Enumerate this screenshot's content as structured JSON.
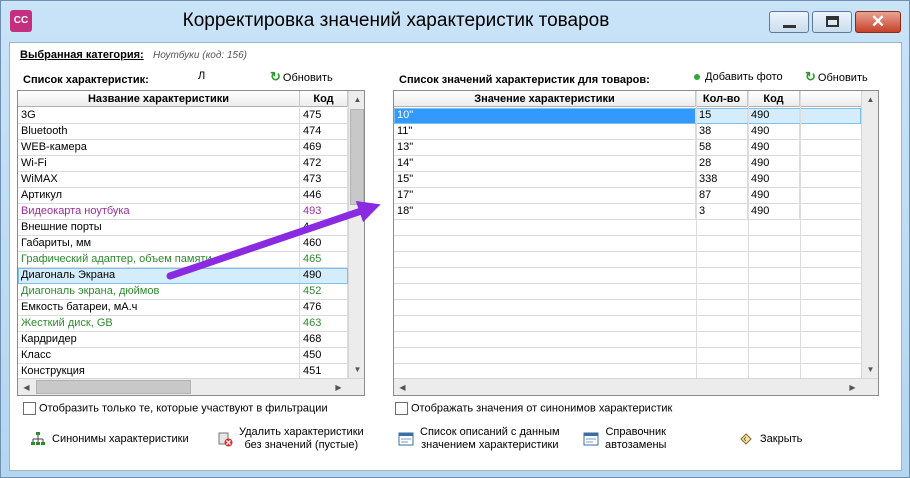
{
  "window": {
    "title": "Корректировка значений характеристик товаров",
    "icon_text": "CC",
    "close_glyph": "✕"
  },
  "category": {
    "label": "Выбранная категория:",
    "value": "Ноутбуки (код: 156)"
  },
  "left_panel": {
    "label": "Список характеристик:",
    "marker": "Л",
    "refresh_label": "Обновить",
    "columns": [
      "Название характеристики",
      "Код"
    ],
    "rows": [
      {
        "name": "3G",
        "code": "475",
        "color": "#000000"
      },
      {
        "name": "Bluetooth",
        "code": "474",
        "color": "#000000"
      },
      {
        "name": "WEB-камера",
        "code": "469",
        "color": "#000000"
      },
      {
        "name": "Wi-Fi",
        "code": "472",
        "color": "#000000"
      },
      {
        "name": "WiMAX",
        "code": "473",
        "color": "#000000"
      },
      {
        "name": "Артикул",
        "code": "446",
        "color": "#000000"
      },
      {
        "name": "Видеокарта ноутбука",
        "code": "493",
        "color": "#9b2d9b"
      },
      {
        "name": "Внешние порты",
        "code": "4",
        "color": "#000000"
      },
      {
        "name": "Габариты, мм",
        "code": "460",
        "color": "#000000"
      },
      {
        "name": "Графический адаптер, объем памяти",
        "code": "465",
        "color": "#2e8b2e"
      },
      {
        "name": "Диагональ Экрана",
        "code": "490",
        "color": "#000000",
        "selected": true
      },
      {
        "name": "Диагональ экрана, дюймов",
        "code": "452",
        "color": "#2e8b2e"
      },
      {
        "name": "Емкость батареи, мА.ч",
        "code": "476",
        "color": "#000000"
      },
      {
        "name": "Жесткий диск, GB",
        "code": "463",
        "color": "#2e8b2e"
      },
      {
        "name": "Кардридер",
        "code": "468",
        "color": "#000000"
      },
      {
        "name": "Класс",
        "code": "450",
        "color": "#000000"
      },
      {
        "name": "Конструкция",
        "code": "451",
        "color": "#000000"
      }
    ],
    "filter_checkbox_label": "Отобразить только те, которые участвуют в фильтрации"
  },
  "right_panel": {
    "label": "Список значений характеристик для товаров:",
    "add_photo_label": "Добавить фото",
    "refresh_label": "Обновить",
    "columns": [
      "Значение характеристики",
      "Кол-во",
      "Код"
    ],
    "rows": [
      {
        "value": "10\"",
        "count": "15",
        "code": "490",
        "selected": true
      },
      {
        "value": "11\"",
        "count": "38",
        "code": "490"
      },
      {
        "value": "13\"",
        "count": "58",
        "code": "490"
      },
      {
        "value": "14\"",
        "count": "28",
        "code": "490"
      },
      {
        "value": "15\"",
        "count": "338",
        "code": "490"
      },
      {
        "value": "17\"",
        "count": "87",
        "code": "490"
      },
      {
        "value": "18\"",
        "count": "3",
        "code": "490"
      }
    ],
    "synonyms_checkbox_label": "Отображать значения от синонимов характеристик"
  },
  "toolbar": {
    "synonyms_label": "Синонимы характеристики",
    "delete_line1": "Удалить характеристики",
    "delete_line2": "без значений (пустые)",
    "descriptions_line1": "Список описаний с данным",
    "descriptions_line2": "значением характеристики",
    "dictionary_line1": "Справочник",
    "dictionary_line2": "автозамены",
    "close_label": "Закрыть"
  },
  "colors": {
    "accent_arrow": "#8a2be2",
    "selection": "#3399ff"
  }
}
